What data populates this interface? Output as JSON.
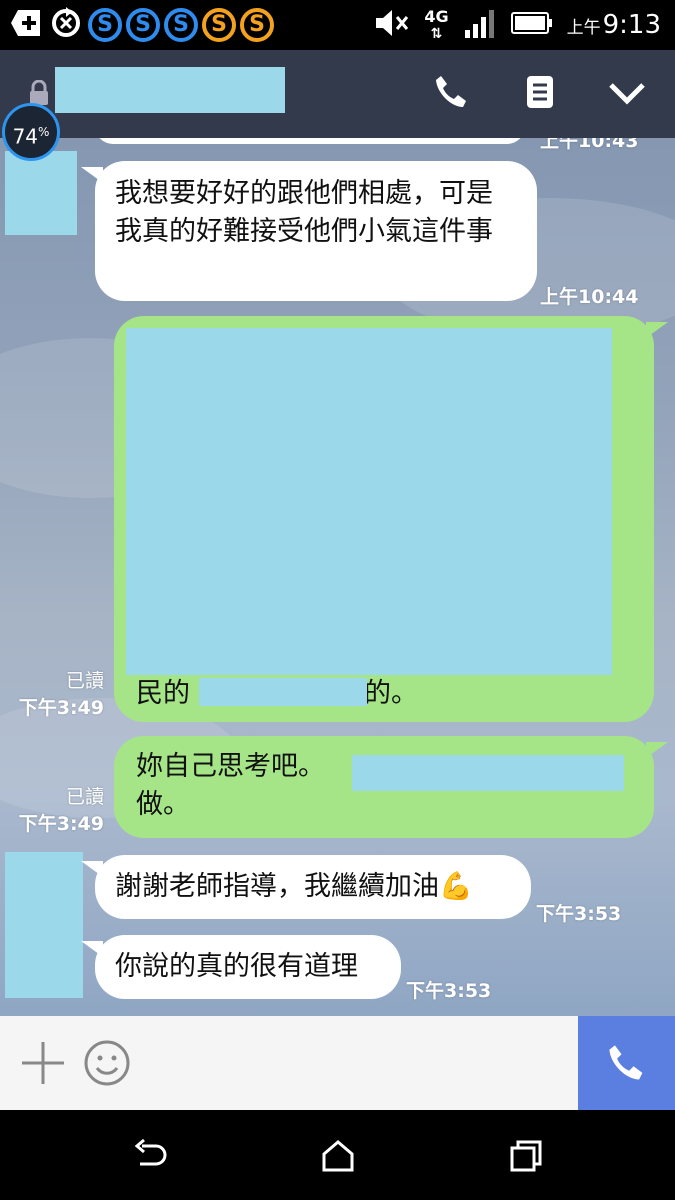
{
  "status_bar": {
    "clock_ampm": "上午",
    "clock_time": "9:13",
    "network": "4G",
    "coins": [
      "S",
      "S",
      "S",
      "S",
      "S"
    ],
    "icons": [
      "plus-square-icon",
      "sync-icon",
      "mute-icon",
      "signal-icon",
      "battery-icon"
    ]
  },
  "header": {
    "icons": [
      "lock-icon",
      "phone-icon",
      "notes-icon",
      "chevron-down-icon"
    ]
  },
  "overlay": {
    "battery_percent": "74",
    "percent_sign": "%"
  },
  "messages": [
    {
      "side": "in",
      "text": "我想要好好的跟他們相處，可是我真的好難接受他們小氣這件事",
      "time": "上午10:44",
      "prev_time": "上午10:43"
    },
    {
      "side": "out",
      "visible_text_start": "民的",
      "visible_text_end": "的。",
      "read": "已讀",
      "time": "下午3:49"
    },
    {
      "side": "out",
      "line1": "妳自己思考吧。",
      "line2": "做。",
      "read": "已讀",
      "time": "下午3:49"
    },
    {
      "side": "in",
      "text": "謝謝老師指導，我繼續加油",
      "emoji": "💪",
      "time": "下午3:53"
    },
    {
      "side": "in",
      "text": "你說的真的很有道理",
      "time": "下午3:53"
    }
  ],
  "input_bar": {
    "icons": [
      "plus-icon",
      "emoji-icon",
      "call-icon"
    ]
  },
  "nav_bar": {
    "icons": [
      "back-icon",
      "home-icon",
      "recents-icon"
    ]
  },
  "colors": {
    "incoming_bubble": "#ffffff",
    "outgoing_bubble": "#a6e587",
    "header": "#333a4b",
    "send_button": "#5a7fe0",
    "redaction": "#9ad8ea"
  }
}
